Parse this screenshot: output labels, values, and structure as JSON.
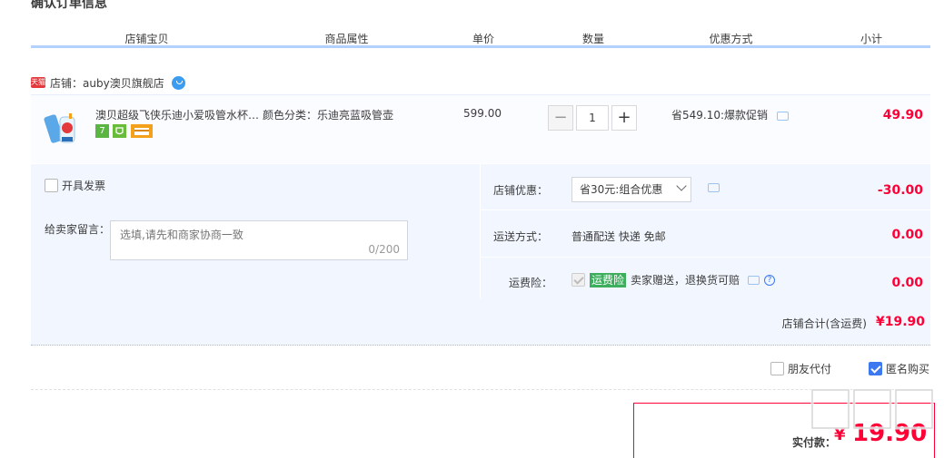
{
  "page": {
    "title": "确认订单信息"
  },
  "columns": [
    "店铺宝贝",
    "商品属性",
    "单价",
    "数量",
    "优惠方式",
    "小计"
  ],
  "shop": {
    "prefix": "店铺：",
    "name": "auby澳贝旗舰店",
    "tmall_badge": "天猫"
  },
  "item": {
    "title": "澳贝超级飞侠乐迪小爱吸管水杯…",
    "attr": "颜色分类：乐迪亮蓝吸管壶",
    "price": "599.00",
    "qty_minus": "−",
    "qty": "1",
    "qty_plus": "+",
    "promo": "省549.10:爆款促销",
    "subtotal": "49.90",
    "badges": [
      {
        "name": "seven-day-return-icon",
        "text": "7",
        "color": "#5bb543"
      },
      {
        "name": "guarantee-icon",
        "text": "",
        "color": "#69bb3b"
      },
      {
        "name": "credit-card-icon",
        "text": "",
        "color": "#f3a01a"
      }
    ]
  },
  "invoice": {
    "label": "开具发票"
  },
  "remark": {
    "label": "给卖家留言：",
    "placeholder": "选填,请先和商家协商一致",
    "count": "0/200"
  },
  "shop_discount": {
    "label": "店铺优惠：",
    "selected": "省30元:组合优惠",
    "amount": "-30.00"
  },
  "shipping": {
    "label": "运送方式：",
    "value": "普通配送 快递 免邮",
    "amount": "0.00"
  },
  "insurance": {
    "label": "运费险：",
    "tag": "运费险",
    "desc": "卖家赠送，退换货可赔",
    "help": "?",
    "amount": "0.00"
  },
  "shop_total": {
    "label": "店铺合计(含运费)",
    "amount": "¥19.90"
  },
  "pay_options": {
    "friend_pay": "朋友代付",
    "anonymous": "匿名购买"
  },
  "summary": {
    "label": "实付款：",
    "currency": "¥",
    "amount": "19.90"
  },
  "colors": {
    "accent": "#ff0036",
    "header_border": "#b2d1ff",
    "panel_bg": "#f2f7ff",
    "checkbox_blue": "#3c78f0"
  }
}
